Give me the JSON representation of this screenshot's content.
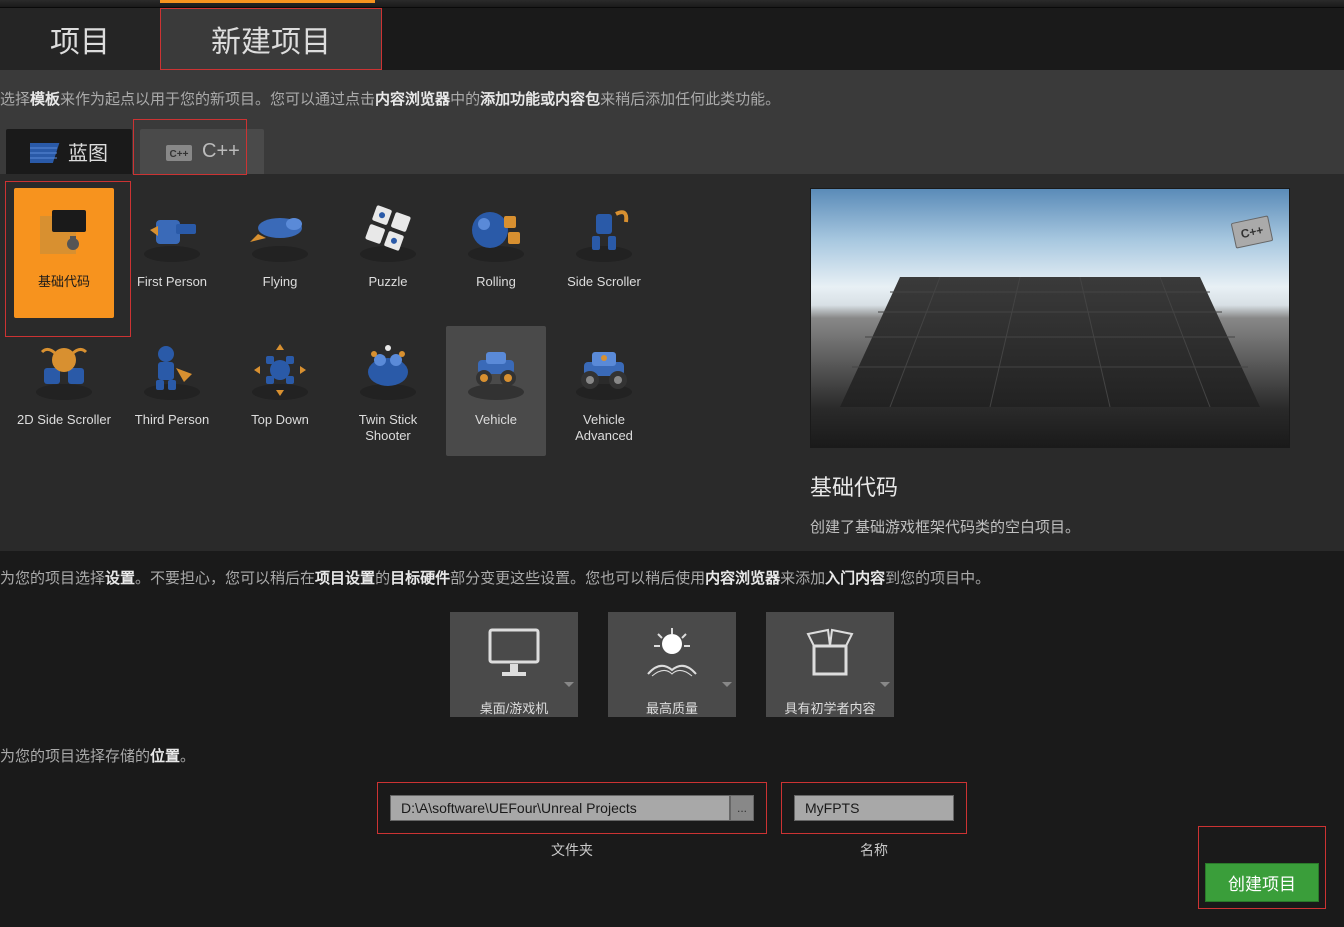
{
  "mainTabs": {
    "project": "项目",
    "newProject": "新建项目"
  },
  "intro": {
    "p1": "选择",
    "b1": "模板",
    "p2": "来作为起点以用于您的新项目。您可以通过点击",
    "b2": "内容浏览器",
    "p3": "中的",
    "b3": "添加功能或内容包",
    "p4": "来稍后添加任何此类功能。"
  },
  "subTabs": {
    "blueprint": "蓝图",
    "cpp": "C++"
  },
  "templates": [
    {
      "label": "基础代码",
      "selected": true,
      "kind": "basic"
    },
    {
      "label": "First Person",
      "kind": "firstperson"
    },
    {
      "label": "Flying",
      "kind": "flying"
    },
    {
      "label": "Puzzle",
      "kind": "puzzle"
    },
    {
      "label": "Rolling",
      "kind": "rolling"
    },
    {
      "label": "Side Scroller",
      "kind": "sidescroller"
    },
    {
      "label": "2D Side Scroller",
      "kind": "2dscroller"
    },
    {
      "label": "Third Person",
      "kind": "thirdperson"
    },
    {
      "label": "Top Down",
      "kind": "topdown"
    },
    {
      "label": "Twin Stick Shooter",
      "kind": "twinstick"
    },
    {
      "label": "Vehicle",
      "hover": true,
      "kind": "vehicle"
    },
    {
      "label": "Vehicle Advanced",
      "kind": "vehicleadv"
    }
  ],
  "preview": {
    "title": "基础代码",
    "desc": "创建了基础游戏框架代码类的空白项目。",
    "badge": "C++"
  },
  "settings": {
    "p1": "为您的项目选择",
    "b1": "设置",
    "p2": "。不要担心，您可以稍后在",
    "b2": "项目设置",
    "p3": "的",
    "b3": "目标硬件",
    "p4": "部分变更这些设置。您也可以稍后使用",
    "b4": "内容浏览器",
    "p5": "来添加",
    "b5": "入门内容",
    "p6": "到您的项目中。"
  },
  "options": [
    {
      "label": "桌面/游戏机",
      "kind": "desktop"
    },
    {
      "label": "最高质量",
      "kind": "quality"
    },
    {
      "label": "具有初学者内容",
      "kind": "starter"
    }
  ],
  "location": {
    "p1": "为您的项目选择存储的",
    "b1": "位置",
    "p2": "。"
  },
  "path": {
    "folderValue": "D:\\A\\software\\UEFour\\Unreal Projects",
    "folderLabel": "文件夹",
    "browseDots": "...",
    "nameValue": "MyFPTS",
    "nameLabel": "名称"
  },
  "createButton": "创建项目"
}
